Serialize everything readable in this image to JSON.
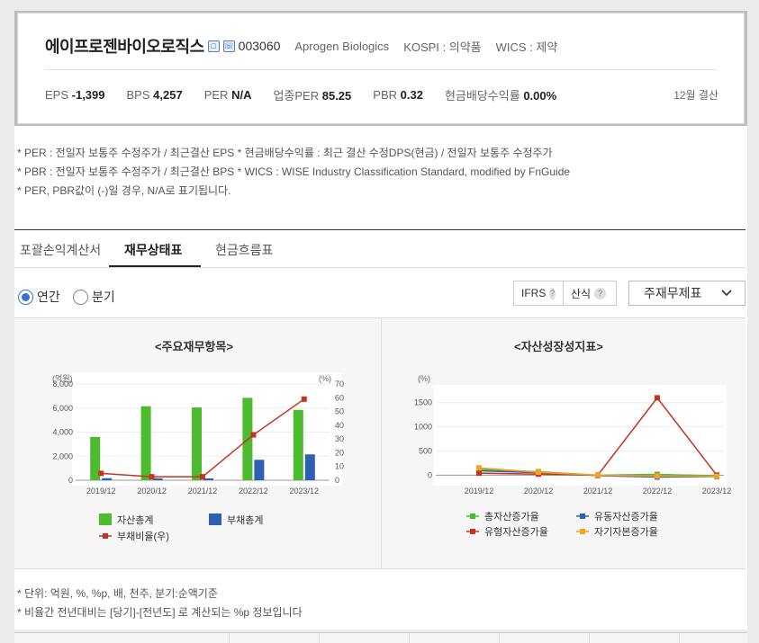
{
  "company": {
    "name": "에이프로젠바이오로직스",
    "icon1": "□",
    "icon2": "☏",
    "code": "003060",
    "english_name": "Aprogen Biologics",
    "market": "KOSPI : 의약품",
    "wics": "WICS : 제약"
  },
  "stats": [
    {
      "label": "EPS",
      "value": "-1,399"
    },
    {
      "label": "BPS",
      "value": "4,257"
    },
    {
      "label": "PER",
      "value": "N/A"
    },
    {
      "label": "업종PER",
      "value": "85.25"
    },
    {
      "label": "PBR",
      "value": "0.32"
    },
    {
      "label": "현금배당수익률",
      "value": "0.00%"
    }
  ],
  "settlement": "12월 결산",
  "notes": [
    "* PER : 전일자 보통주 수정주가 / 최근결산 EPS * 현금배당수익률 : 최근 결산 수정DPS(현금) / 전일자 보통주 수정주가",
    "* PBR : 전일자 보통주 수정주가 / 최근결산 BPS * WICS : WISE Industry Classification Standard, modified by FnGuide",
    "* PER, PBR값이 (-)일 경우, N/A로 표기됩니다."
  ],
  "tabs": [
    "포괄손익계산서",
    "재무상태표",
    "현금흐름표"
  ],
  "period_options": {
    "annual": "연간",
    "quarter": "분기"
  },
  "toolbar": {
    "ifrs": "IFRS",
    "calc": "산식",
    "help": "?",
    "select_value": "주재무제표"
  },
  "bottom_notes": [
    "* 단위: 억원, %, %p, 배, 천주, 분기:순액기준",
    "* 비율간 전년대비는 [당기]-[전년도] 로 계산되는 %p 정보입니다"
  ],
  "colors": {
    "green": "#4cbb2f",
    "blue": "#2f5fb3",
    "red": "#c8321e",
    "orange": "#f5a21e"
  },
  "chart_data": [
    {
      "type": "bar",
      "title": "<주요재무항목>",
      "categories": [
        "2019/12",
        "2020/12",
        "2021/12",
        "2022/12",
        "2023/12"
      ],
      "left_unit": "(억원)",
      "right_unit": "(%)",
      "ylim": [
        0,
        8000
      ],
      "y2lim": [
        0,
        70
      ],
      "yticks": [
        "0",
        "2,000",
        "4,000",
        "6,000",
        "8,000"
      ],
      "y2ticks": [
        "0",
        "10",
        "20",
        "30",
        "40",
        "50",
        "60",
        "70"
      ],
      "series": [
        {
          "name": "자산총계",
          "kind": "bar",
          "axis": "left",
          "color": "#4cbb2f",
          "values": [
            3600,
            6150,
            6050,
            6850,
            5850
          ]
        },
        {
          "name": "부채총계",
          "kind": "bar",
          "axis": "left",
          "color": "#2f5fb3",
          "values": [
            170,
            160,
            150,
            1700,
            2150
          ]
        },
        {
          "name": "부채비율(우)",
          "kind": "line",
          "axis": "right",
          "color": "#c8321e",
          "values": [
            5,
            2.5,
            2.5,
            33,
            59
          ]
        }
      ],
      "legend": "bottom"
    },
    {
      "type": "line",
      "title": "<자산성장성지표>",
      "categories": [
        "2019/12",
        "2020/12",
        "2021/12",
        "2022/12",
        "2023/12"
      ],
      "left_unit": "(%)",
      "ylim": [
        -50,
        1700
      ],
      "yticks": [
        "0",
        "500",
        "1000",
        "1500"
      ],
      "series": [
        {
          "name": "총자산증가율",
          "color": "#4cbb2f",
          "values": [
            120,
            70,
            0,
            15,
            -15
          ]
        },
        {
          "name": "유동자산증가율",
          "color": "#2f5fb3",
          "values": [
            90,
            50,
            -10,
            -40,
            -30
          ]
        },
        {
          "name": "유형자산증가율",
          "color": "#c8321e",
          "values": [
            40,
            20,
            0,
            1600,
            0
          ]
        },
        {
          "name": "자기자본증가율",
          "color": "#f5a21e",
          "values": [
            150,
            60,
            0,
            -20,
            -25
          ]
        }
      ],
      "legend": "bottom"
    }
  ]
}
